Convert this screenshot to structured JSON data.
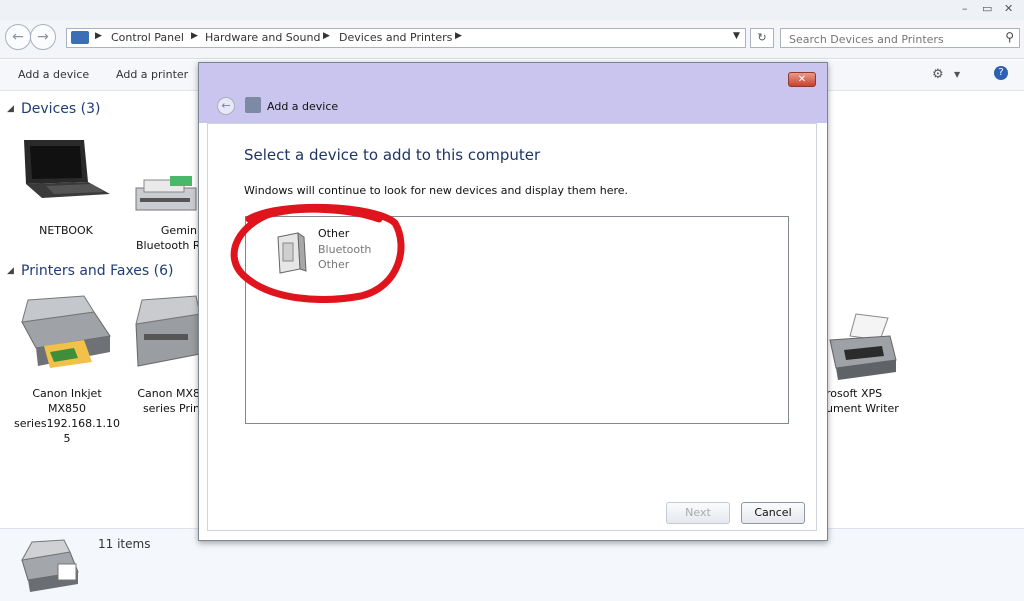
{
  "window": {
    "minimize_label": "–",
    "restore_label": "▭",
    "close_label": "✕"
  },
  "nav": {
    "breadcrumb": [
      "Control Panel",
      "Hardware and Sound",
      "Devices and Printers"
    ],
    "search_placeholder": "Search Devices and Printers"
  },
  "toolbar": {
    "add_device": "Add a device",
    "add_printer": "Add a printer"
  },
  "devices_group": {
    "title": "Devices (3)",
    "items": [
      "NETBOOK",
      "Gemini\nBluetooth R"
    ]
  },
  "printers_group": {
    "title": "Printers and Faxes (6)",
    "items": [
      "Canon Inkjet\nMX850\nseries192.168.1.10\n5",
      "Canon MX8\nseries Prin",
      "rosoft XPS\nument Writer"
    ]
  },
  "status": {
    "items_count": "11 items"
  },
  "dialog": {
    "title": "Add a device",
    "heading": "Select a device to add to this computer",
    "subtext": "Windows will continue to look for new devices and display them here.",
    "device": {
      "name": "Other",
      "line2": "Bluetooth",
      "line3": "Other"
    },
    "next_label": "Next",
    "cancel_label": "Cancel",
    "annotation_color": "#e0141c"
  }
}
